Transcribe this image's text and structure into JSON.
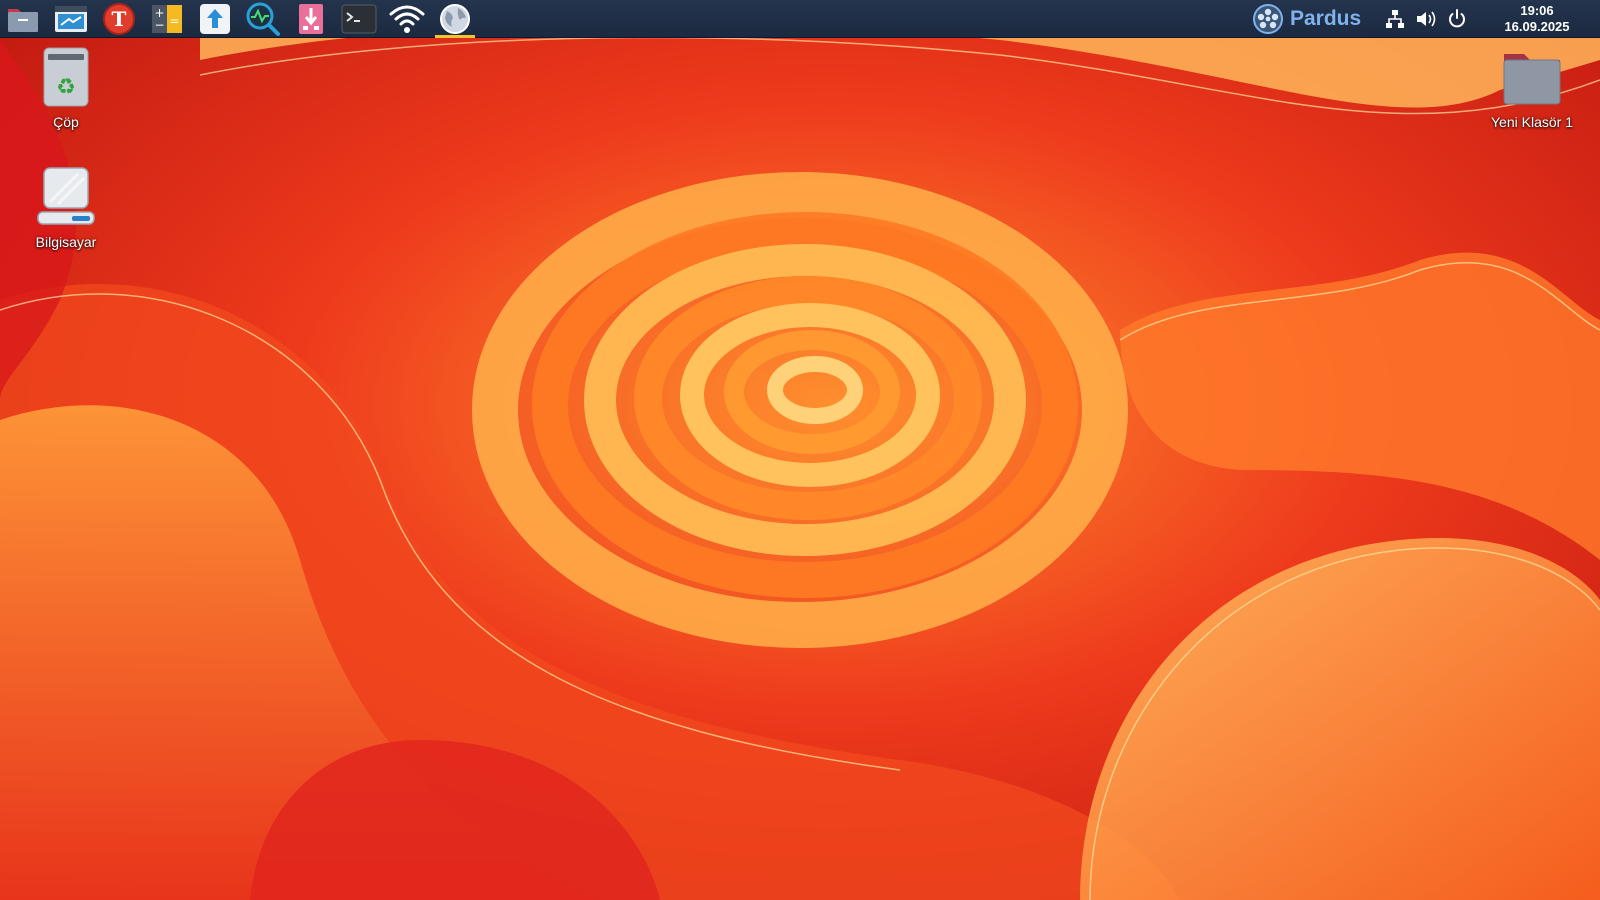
{
  "desktop": {
    "accent_colors": {
      "panel": "#1f2e45",
      "brand": "#7fb2ec",
      "active_indicator": "#f2c530",
      "wallpaper_primary": "#e52a1d",
      "wallpaper_secondary": "#ff9a2e"
    },
    "icons": [
      {
        "label": "Çöp",
        "icon": "trash-icon"
      },
      {
        "label": "Bilgisayar",
        "icon": "computer-icon"
      },
      {
        "label": "Yeni Klasör 1",
        "icon": "folder-icon"
      }
    ]
  },
  "panel": {
    "launchers": [
      {
        "icon": "file-manager-icon",
        "active": false
      },
      {
        "icon": "software-center-icon",
        "active": false
      },
      {
        "icon": "text-editor-icon",
        "active": false
      },
      {
        "icon": "calculator-icon",
        "active": false
      },
      {
        "icon": "update-manager-icon",
        "active": false
      },
      {
        "icon": "system-monitor-icon",
        "active": false
      },
      {
        "icon": "usb-writer-icon",
        "active": false
      },
      {
        "icon": "terminal-icon",
        "active": false
      },
      {
        "icon": "wifi-icon",
        "active": false
      },
      {
        "icon": "web-browser-icon",
        "active": true
      }
    ],
    "brand": {
      "label": "Pardus",
      "icon": "pardus-logo-icon"
    },
    "tray": [
      {
        "icon": "network-icon"
      },
      {
        "icon": "volume-icon"
      },
      {
        "icon": "power-icon"
      }
    ],
    "clock": {
      "time": "19:06",
      "date": "16.09.2025"
    }
  }
}
